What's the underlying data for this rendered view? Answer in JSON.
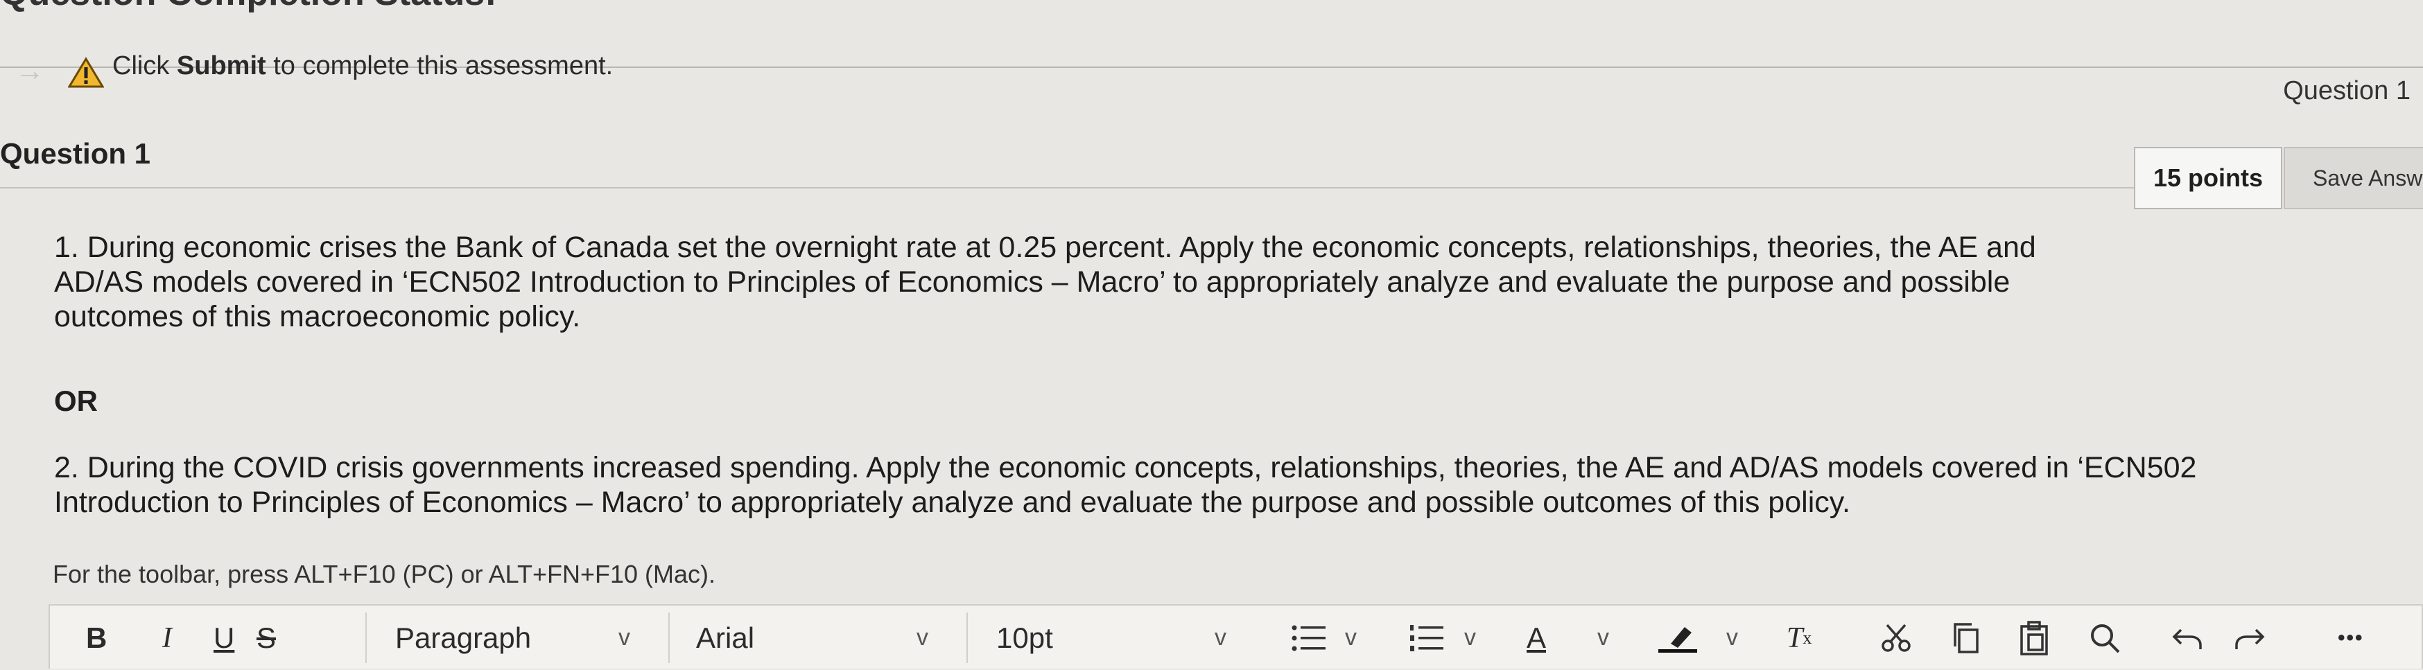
{
  "header": {
    "cut_title": "Question Completion Status:",
    "notice_prefix": "Click ",
    "notice_bold": "Submit",
    "notice_suffix": " to complete this assessment.",
    "question_nav": "Question 1"
  },
  "question": {
    "title": "Question 1",
    "points": "15 points",
    "save_label": "Save Answ",
    "body": {
      "p1_line1": "1. During economic crises the Bank of Canada set the overnight rate at 0.25 percent. Apply the economic concepts, relationships, theories, the AE and",
      "p1_line2": "AD/AS models covered in ‘ECN502 Introduction to Principles of Economics – Macro’ to appropriately analyze and evaluate the purpose and possible",
      "p1_line3": "outcomes of this macroeconomic policy.",
      "or": "OR",
      "p2_line1": "2. During the COVID crisis governments increased spending. Apply the economic concepts, relationships, theories, the AE and AD/AS models covered in ‘ECN502",
      "p2_line2": "Introduction to Principles of Economics – Macro’ to appropriately analyze and evaluate the purpose and possible outcomes of this policy."
    }
  },
  "editor": {
    "toolbar_hint": "For the toolbar, press ALT+F10 (PC) or ALT+FN+F10 (Mac).",
    "bold": "B",
    "italic": "I",
    "underline": "U",
    "strike": "S",
    "paragraph": "Paragraph",
    "font": "Arial",
    "size": "10pt",
    "text_color": "A",
    "more": "•••"
  }
}
